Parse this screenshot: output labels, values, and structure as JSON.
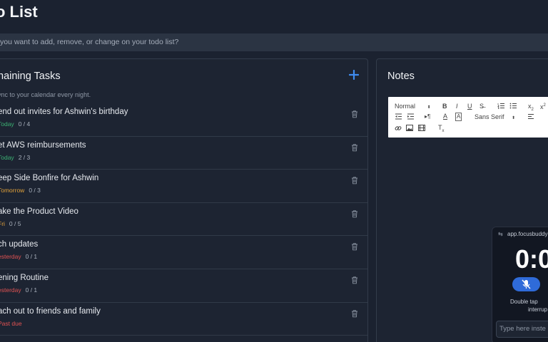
{
  "page": {
    "title": "o List"
  },
  "prompt": {
    "placeholder": "you want to add, remove, or change on your todo list?"
  },
  "tasks_panel": {
    "title": "naining Tasks",
    "sync_note": "ync to your calendar every night.",
    "tasks": [
      {
        "title": "end out invites for Ashwin's birthday",
        "due": "Today",
        "due_color": "#3bb273",
        "progress": "0 / 4"
      },
      {
        "title": "et AWS reimbursements",
        "due": "Today",
        "due_color": "#3bb273",
        "progress": "2 / 3"
      },
      {
        "title": "eep Side Bonfire for Ashwin",
        "due": "Tomorrow",
        "due_color": "#e0a13a",
        "progress": "0 / 3"
      },
      {
        "title": "ake the Product Video",
        "due": "Fri",
        "due_color": "#e0a13a",
        "progress": "0 / 5"
      },
      {
        "title": "ch updates",
        "due": "esterday",
        "due_color": "#e05252",
        "progress": "0 / 1"
      },
      {
        "title": "ening Routine",
        "due": "esterday",
        "due_color": "#e05252",
        "progress": "0 / 1"
      },
      {
        "title": "ach out to friends and family",
        "due": "Past due",
        "due_color": "#e05252",
        "progress": ""
      }
    ]
  },
  "notes_panel": {
    "title": "Notes",
    "toolbar": {
      "heading_select": "Normal",
      "font_select": "Sans Serif"
    }
  },
  "focus_widget": {
    "url": "app.focusbuddy",
    "timer": "0:0",
    "hint_line1": "Double tap",
    "hint_line2": "interrup",
    "input_placeholder": "Type here inste"
  },
  "colors": {
    "accent": "#3f8cf0",
    "background": "#1b2230",
    "mic_button": "#2f6bd9"
  }
}
